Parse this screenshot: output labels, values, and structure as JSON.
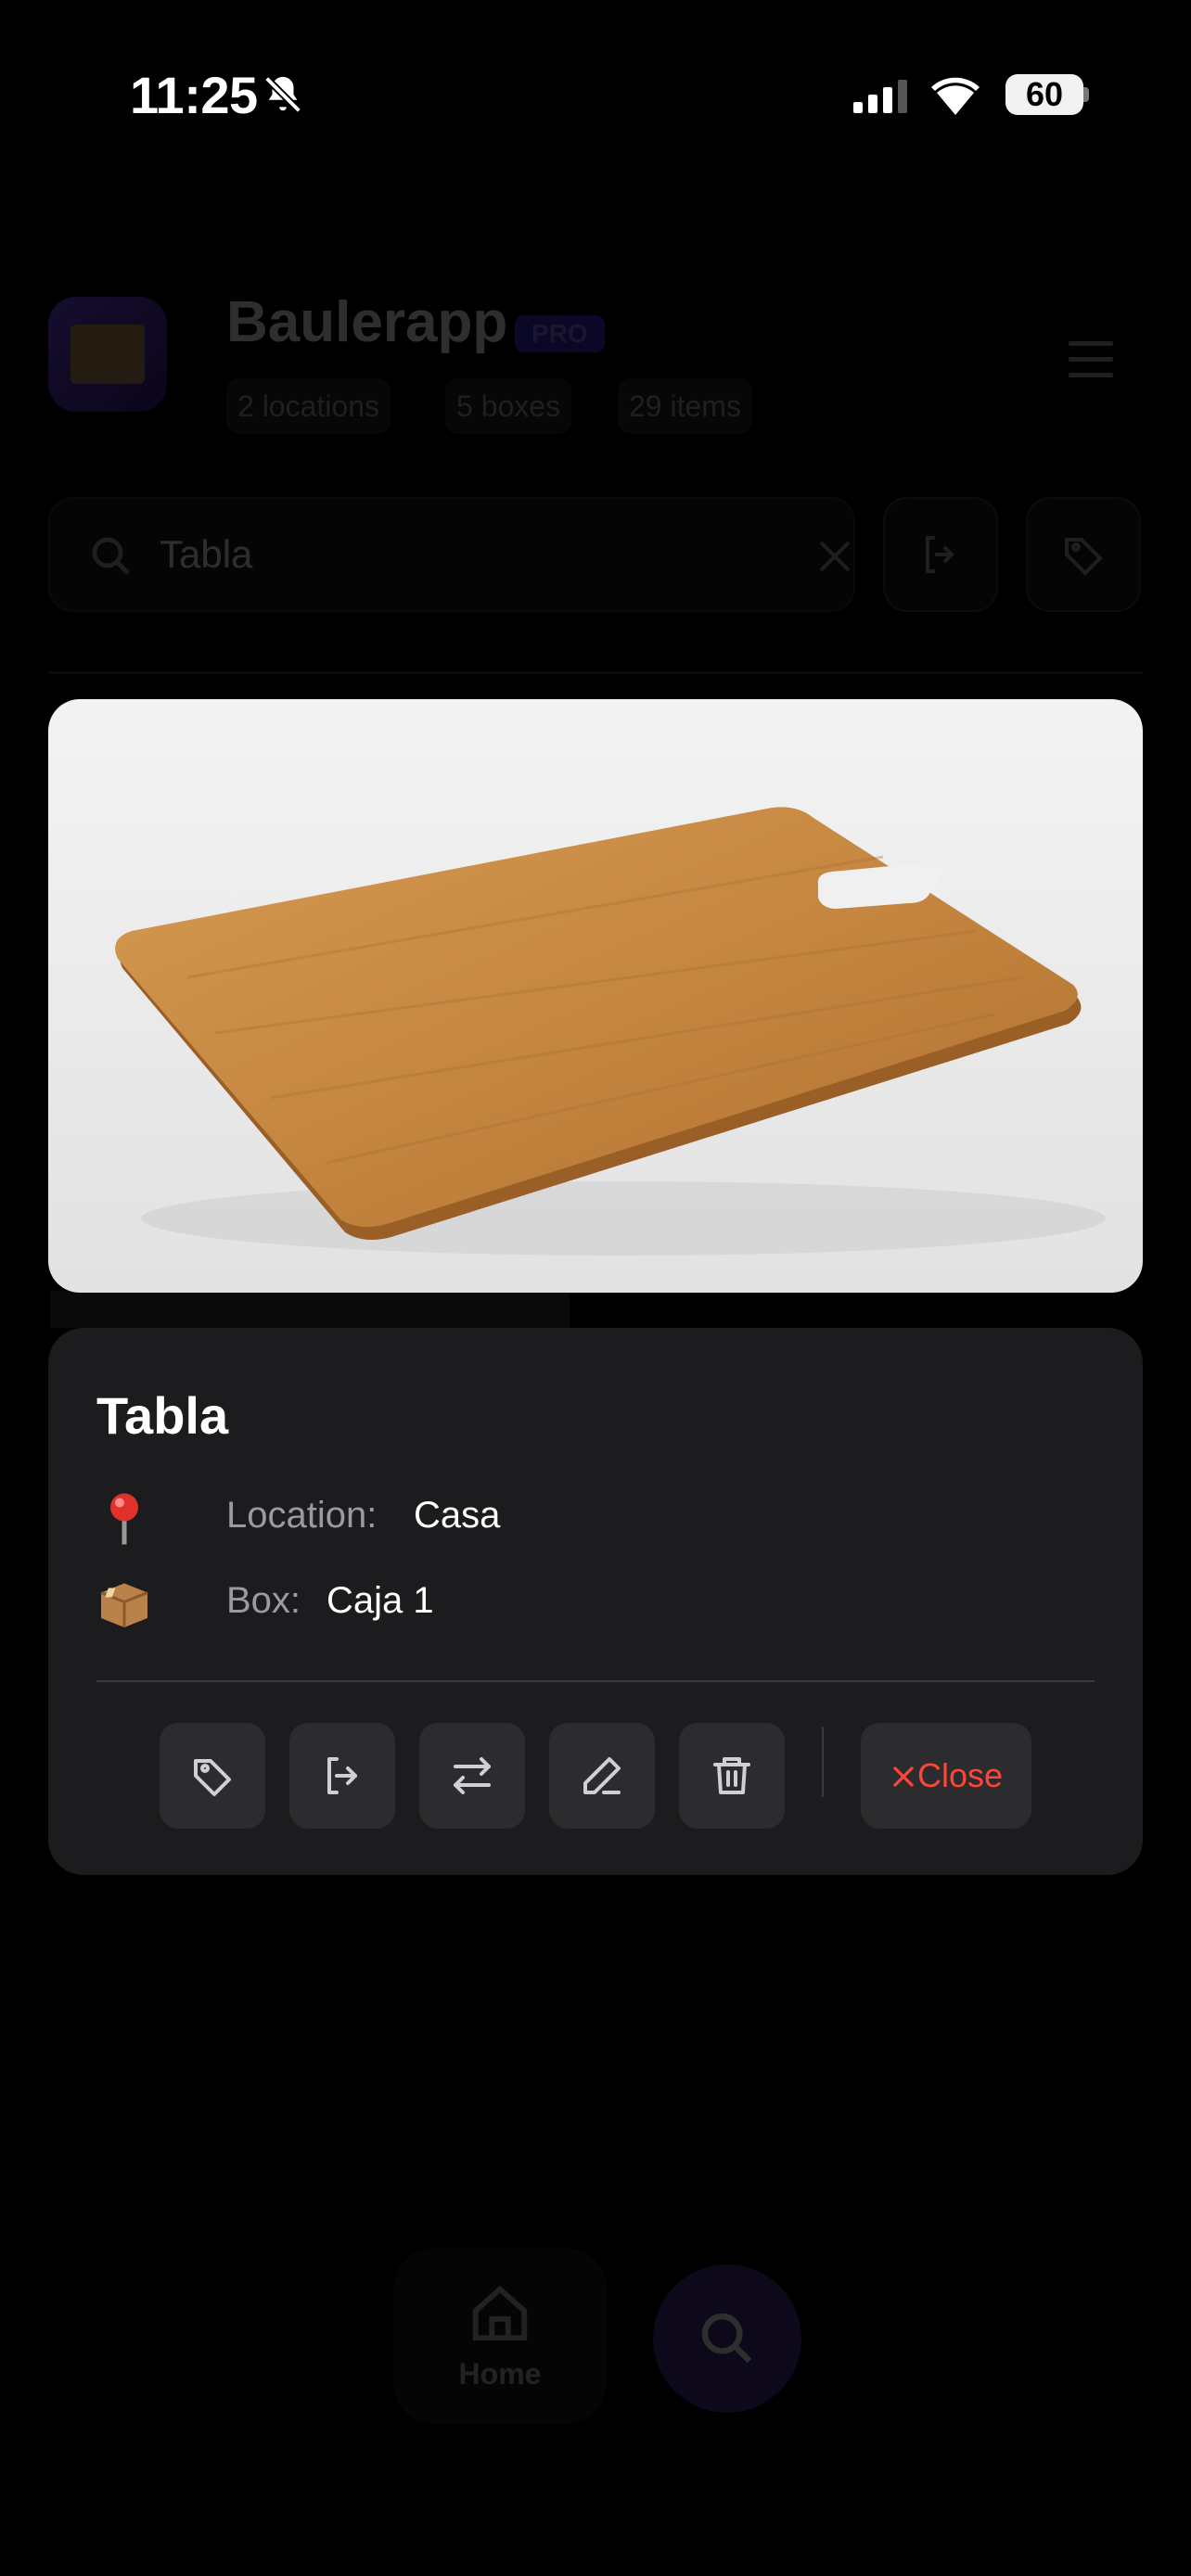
{
  "status_bar": {
    "time": "11:25",
    "battery": "60"
  },
  "app": {
    "title": "Baulerapp",
    "badge": "PRO",
    "chips": [
      "2 locations",
      "5 boxes",
      "29 items"
    ]
  },
  "search": {
    "value": "Tabla"
  },
  "detail": {
    "title": "Tabla",
    "location_label": "Location:",
    "location_value": "Casa",
    "box_label": "Box:",
    "box_value": "Caja 1",
    "close_label": "Close",
    "actions": [
      "tag-icon",
      "checkout-icon",
      "move-icon",
      "edit-icon",
      "trash-icon"
    ]
  },
  "bottom_nav": {
    "home_label": "Home"
  },
  "colors": {
    "accent_purple": "#6a4cff",
    "danger": "#ff453a",
    "card_bg": "#1c1c1e"
  }
}
